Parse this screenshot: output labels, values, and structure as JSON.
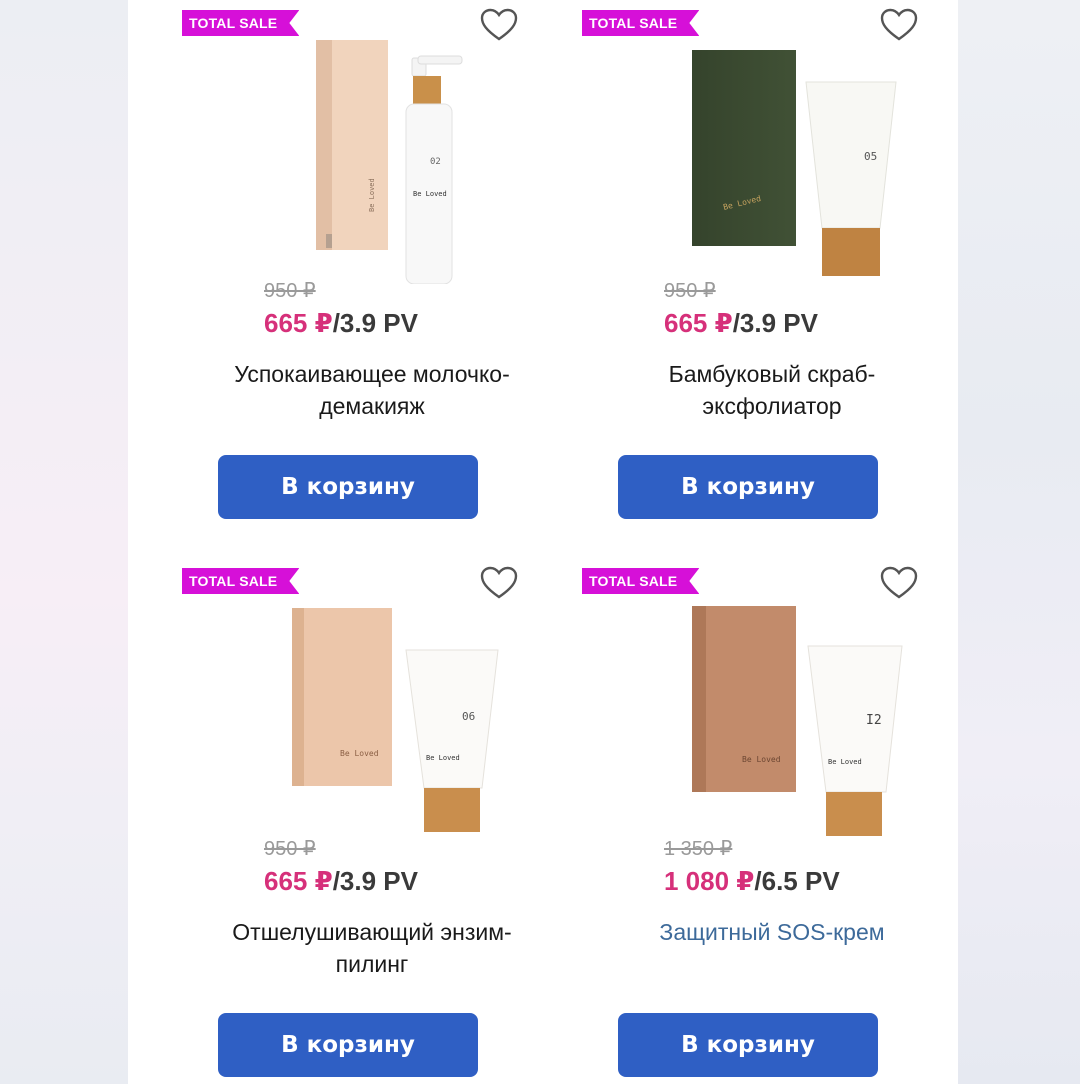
{
  "colors": {
    "badge": "#d610d8",
    "new_price": "#d6307a",
    "button": "#2f5fc4",
    "link": "#3d6a9a"
  },
  "products": [
    {
      "badge": "TOTAL SALE",
      "old_price": "950 ₽",
      "new_price": "665 ₽",
      "pv": "/3.9 PV",
      "name": "Успокаивающее молочко-демакияж",
      "button": "В корзину",
      "icon": "heart-icon",
      "product_number": "02",
      "brand": "Be Loved"
    },
    {
      "badge": "TOTAL SALE",
      "old_price": "950 ₽",
      "new_price": "665 ₽",
      "pv": "/3.9 PV",
      "name": "Бамбуковый скраб-эксфолиатор",
      "button": "В корзину",
      "icon": "heart-icon",
      "product_number": "05",
      "brand": "Be Loved"
    },
    {
      "badge": "TOTAL SALE",
      "old_price": "950 ₽",
      "new_price": "665 ₽",
      "pv": "/3.9 PV",
      "name": "Отшелушивающий энзим-пилинг",
      "button": "В корзину",
      "icon": "heart-icon",
      "product_number": "06",
      "brand": "Be Loved"
    },
    {
      "badge": "TOTAL SALE",
      "old_price": "1 350 ₽",
      "new_price": "1 080 ₽",
      "pv": "/6.5 PV",
      "name": "Защитный SOS-крем",
      "button": "В корзину",
      "icon": "heart-icon",
      "product_number": "I2",
      "brand": "Be Loved"
    }
  ]
}
